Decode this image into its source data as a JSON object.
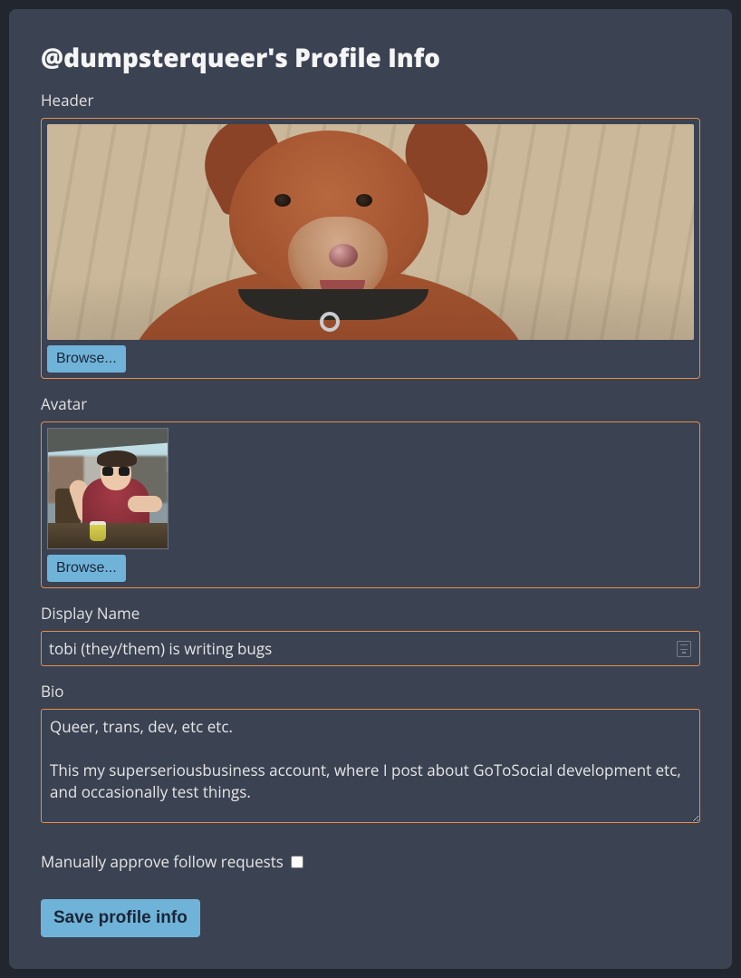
{
  "title": "@dumpsterqueer's Profile Info",
  "colors": {
    "accent": "#e58f4a",
    "button": "#6fb4d8",
    "panel": "#3b4252",
    "page": "#22272f"
  },
  "header": {
    "label": "Header",
    "browse_label": "Browse...",
    "image_description": "dog-photo"
  },
  "avatar": {
    "label": "Avatar",
    "browse_label": "Browse...",
    "image_description": "person-photo"
  },
  "display_name": {
    "label": "Display Name",
    "value": "tobi (they/them) is writing bugs"
  },
  "bio": {
    "label": "Bio",
    "value": "Queer, trans, dev, etc etc.\n\nThis my superseriousbusiness account, where I post about GoToSocial development etc, and occasionally test things."
  },
  "approve": {
    "label": "Manually approve follow requests",
    "checked": false
  },
  "save_label": "Save profile info"
}
